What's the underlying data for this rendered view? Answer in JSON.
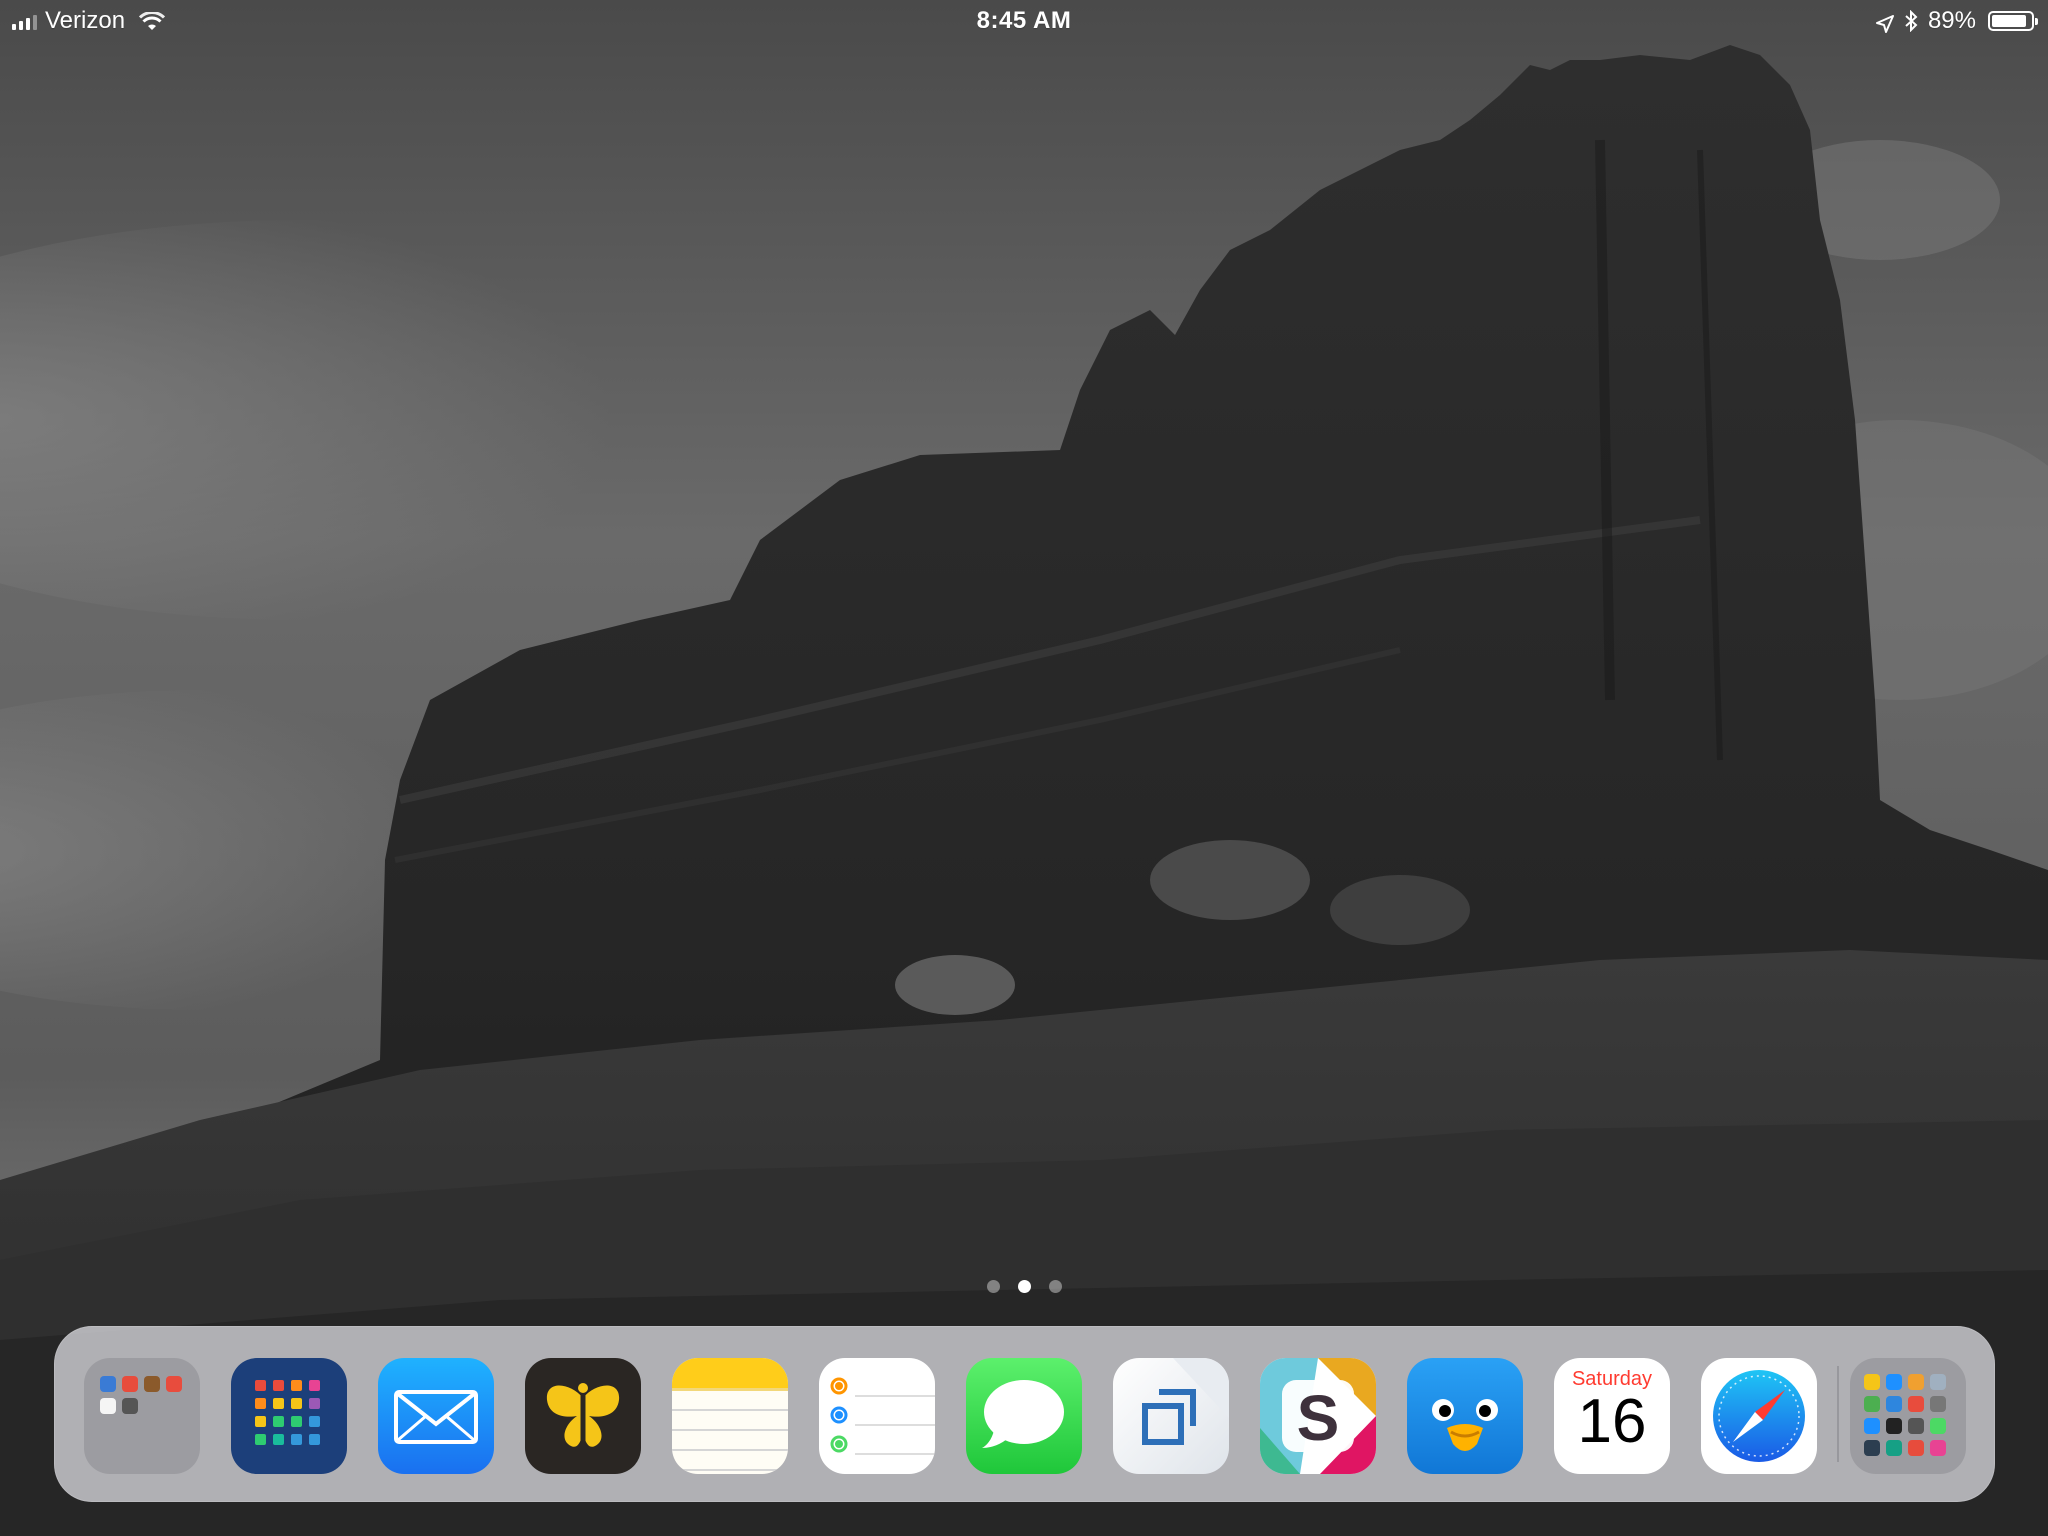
{
  "status_bar": {
    "carrier": "Verizon",
    "time": "8:45 AM",
    "battery_percent": "89%",
    "battery_level": 0.89,
    "signal_bars_filled": 3,
    "icons": [
      "signal-icon",
      "wifi-icon",
      "location-icon",
      "bluetooth-icon",
      "battery-icon"
    ]
  },
  "page_indicator": {
    "count": 3,
    "active_index": 1
  },
  "dock": {
    "apps": [
      {
        "name": "folder",
        "icon": "app-folder-icon"
      },
      {
        "name": "Workflow",
        "icon": "workflow-icon",
        "color": "#1c3f7a"
      },
      {
        "name": "Mail",
        "icon": "mail-icon",
        "color": "#1e8cf6"
      },
      {
        "name": "Ulysses",
        "icon": "ulysses-icon",
        "color": "#2a2623"
      },
      {
        "name": "Notes",
        "icon": "notes-icon",
        "color": "#ffd60a"
      },
      {
        "name": "Reminders",
        "icon": "reminders-icon",
        "color": "#ffffff"
      },
      {
        "name": "Messages",
        "icon": "messages-icon",
        "color": "#33d44f"
      },
      {
        "name": "Copied",
        "icon": "copied-icon",
        "color": "#eef1f5"
      },
      {
        "name": "Slack",
        "icon": "slack-icon",
        "color": "#ffffff"
      },
      {
        "name": "Tweetbot",
        "icon": "tweetbot-icon",
        "color": "#1a8cf0"
      },
      {
        "name": "Calendar",
        "icon": "calendar-icon",
        "day": "Saturday",
        "date": "16"
      },
      {
        "name": "Safari",
        "icon": "safari-icon",
        "color": "#1e90ff"
      },
      {
        "name": "recent folder",
        "icon": "recent-apps-folder-icon"
      }
    ]
  }
}
